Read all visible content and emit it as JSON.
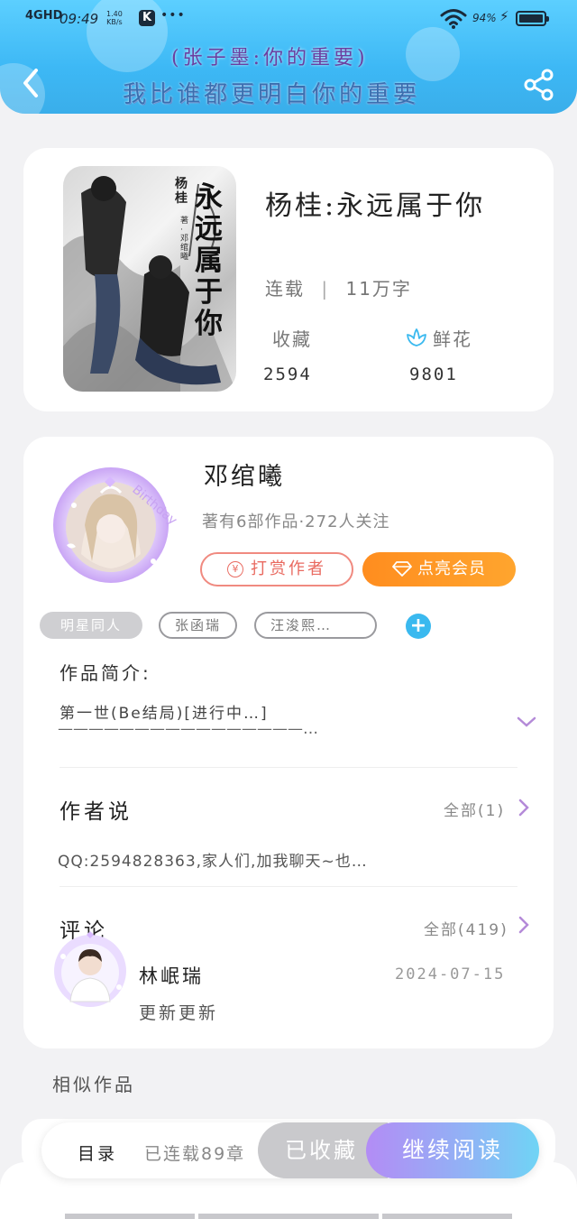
{
  "status_bar": {
    "network": "4GHD",
    "time": "09:49",
    "speed_value": "1.40",
    "speed_unit": "KB/s",
    "app_badge": "K",
    "more": "•••",
    "battery": "94%"
  },
  "header": {
    "banner_line1": "(张子墨:你的重要)",
    "banner_line2": "我比谁都更明白你的重要"
  },
  "book": {
    "title": "杨桂:永远属于你",
    "status": "连载",
    "separator": "|",
    "word_count": "11万字",
    "collect_label": "收藏",
    "collect_count": "2594",
    "flower_label": "鲜花",
    "flower_count": "9801",
    "cover": {
      "title_text": "永远属于你",
      "author_text": "杨桂",
      "author_note": "著·邓绾曦"
    }
  },
  "author": {
    "name": "邓绾曦",
    "stats": "著有6部作品·272人关注",
    "tip_button": "打赏作者",
    "tip_icon": "¥",
    "vip_button": "点亮会员",
    "avatar_frame_text": "Birthday"
  },
  "tags": [
    "明星同人",
    "张函瑞",
    "汪浚熙…"
  ],
  "intro": {
    "title": "作品简介:",
    "text_line1": "第一世(Be结局)[进行中…]",
    "text_line2": "————————————————…"
  },
  "author_says": {
    "title": "作者说",
    "all_label": "全部(1)",
    "text": "QQ:2594828363,家人们,加我聊天~也…"
  },
  "comments": {
    "title": "评论",
    "all_label": "全部(419)",
    "items": [
      {
        "user": "林岷瑞",
        "date": "2024-07-15",
        "text": "更新更新"
      }
    ]
  },
  "similar": {
    "title": "相似作品"
  },
  "bottom_bar": {
    "toc": "目录",
    "chapters": "已连载89章",
    "collected": "已收藏",
    "continue": "继续阅读"
  },
  "colors": {
    "header_blue": "#3db8f5",
    "tip_red": "#e96a60",
    "vip_orange": "#ff8d1f",
    "tag_add_blue": "#3ab9ef",
    "chevron_purple": "#b48ad8",
    "read_gradient_start": "#b38cf5",
    "read_gradient_end": "#6fd4f5"
  }
}
